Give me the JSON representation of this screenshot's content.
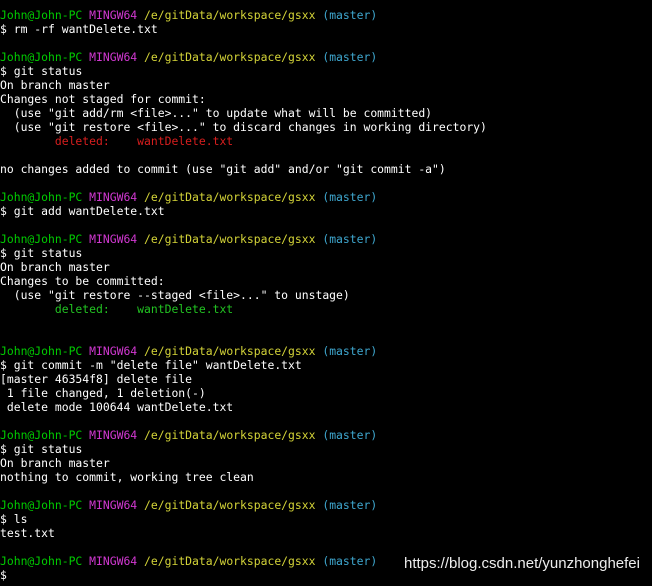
{
  "prompt": {
    "user": "John@John-PC",
    "system": "MINGW64",
    "path": "/e/gitData/workspace/gsxx",
    "branch": "(master)",
    "symbol": "$"
  },
  "colors": {
    "background": "#000000",
    "text": "#ffffff",
    "user": "#00cc00",
    "system": "#d138d1",
    "path": "#d4d438",
    "branch": "#3fa8d0",
    "deleted_unstaged": "#d81e1e",
    "deleted_staged": "#22c322"
  },
  "commands": [
    "rm -rf wantDelete.txt",
    "git status",
    "git add wantDelete.txt",
    "git status",
    "git commit -m \"delete file\" wantDelete.txt",
    "git status",
    "ls",
    ""
  ],
  "output": {
    "status1": {
      "l1": "On branch master",
      "l2": "Changes not staged for commit:",
      "l3": "  (use \"git add/rm <file>...\" to update what will be committed)",
      "l4": "  (use \"git restore <file>...\" to discard changes in working directory)",
      "deleted_label": "        deleted:    wantDelete.txt",
      "l6": "no changes added to commit (use \"git add\" and/or \"git commit -a\")"
    },
    "status2": {
      "l1": "On branch master",
      "l2": "Changes to be committed:",
      "l3": "  (use \"git restore --staged <file>...\" to unstage)",
      "deleted_label": "        deleted:    wantDelete.txt"
    },
    "commit": {
      "l1": "[master 46354f8] delete file",
      "l2": " 1 file changed, 1 deletion(-)",
      "l3": " delete mode 100644 wantDelete.txt"
    },
    "status3": {
      "l1": "On branch master",
      "l2": "nothing to commit, working tree clean"
    },
    "ls": {
      "l1": "test.txt"
    }
  },
  "watermark": "https://blog.csdn.net/yunzhonghefei"
}
